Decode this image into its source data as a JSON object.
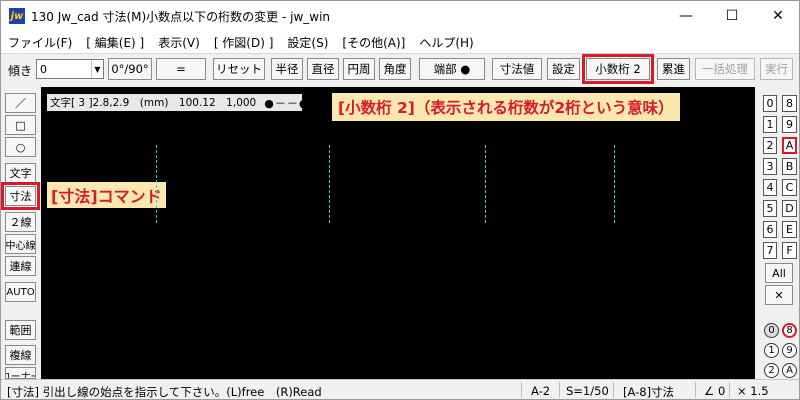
{
  "window": {
    "icon_text": "jw",
    "title": "130 Jw_cad 寸法(M)小数点以下の桁数の変更 - jw_win",
    "minimize": "—",
    "maximize": "☐",
    "close": "✕"
  },
  "menu": [
    "ファイル(F)",
    "[ 編集(E) ]",
    "表示(V)",
    "[ 作図(D) ]",
    "設定(S)",
    "[その他(A)]",
    "ヘルプ(H)"
  ],
  "toolbar": {
    "tilt_label": "傾き",
    "tilt_value": "0",
    "angle_toggle": "0°/90°",
    "equal_button": "=",
    "reset_button": "リセット",
    "radius_button": "半径",
    "diameter_button": "直径",
    "circumference_button": "円周",
    "angle_button": "角度",
    "endpoint_button": "端部 ●",
    "dimension_value_button": "寸法値",
    "settings_button": "設定",
    "decimal_button": "小数桁 2",
    "cumulative_button": "累進",
    "batch_button": "一括処理",
    "execute_button": "実行"
  },
  "left_tools": [
    "／",
    "□",
    "○",
    "文字",
    "寸法",
    "２線",
    "中心線",
    "連線",
    "AUTO",
    "範囲",
    "複線",
    "コーナー"
  ],
  "canvas": {
    "status_text": "文字[ 3 ]2.8,2.9　(mm)　100.12　1,000",
    "status_dots": "●－－●",
    "annotation_decimal": "[小数桁 2]（表示される桁数が2桁という意味）",
    "annotation_command": "[寸法]コマンド"
  },
  "layers": {
    "numbers": [
      "0",
      "1",
      "2",
      "3",
      "4",
      "5",
      "6",
      "7"
    ],
    "letters": [
      "8",
      "9",
      "A",
      "B",
      "C",
      "D",
      "E",
      "F"
    ],
    "all_button": "All",
    "clear_button": "✕",
    "group_left": [
      "0",
      "1",
      "2"
    ],
    "group_right": [
      "8",
      "9",
      "A"
    ]
  },
  "statusbar": {
    "message": "[寸法] 引出し線の始点を指示して下さい。(L)free　(R)Read",
    "paper": "A-2",
    "scale": "S=1/50",
    "layer": "[A-8]寸法",
    "angle": "∠ 0",
    "zoom": "× 1.5"
  }
}
